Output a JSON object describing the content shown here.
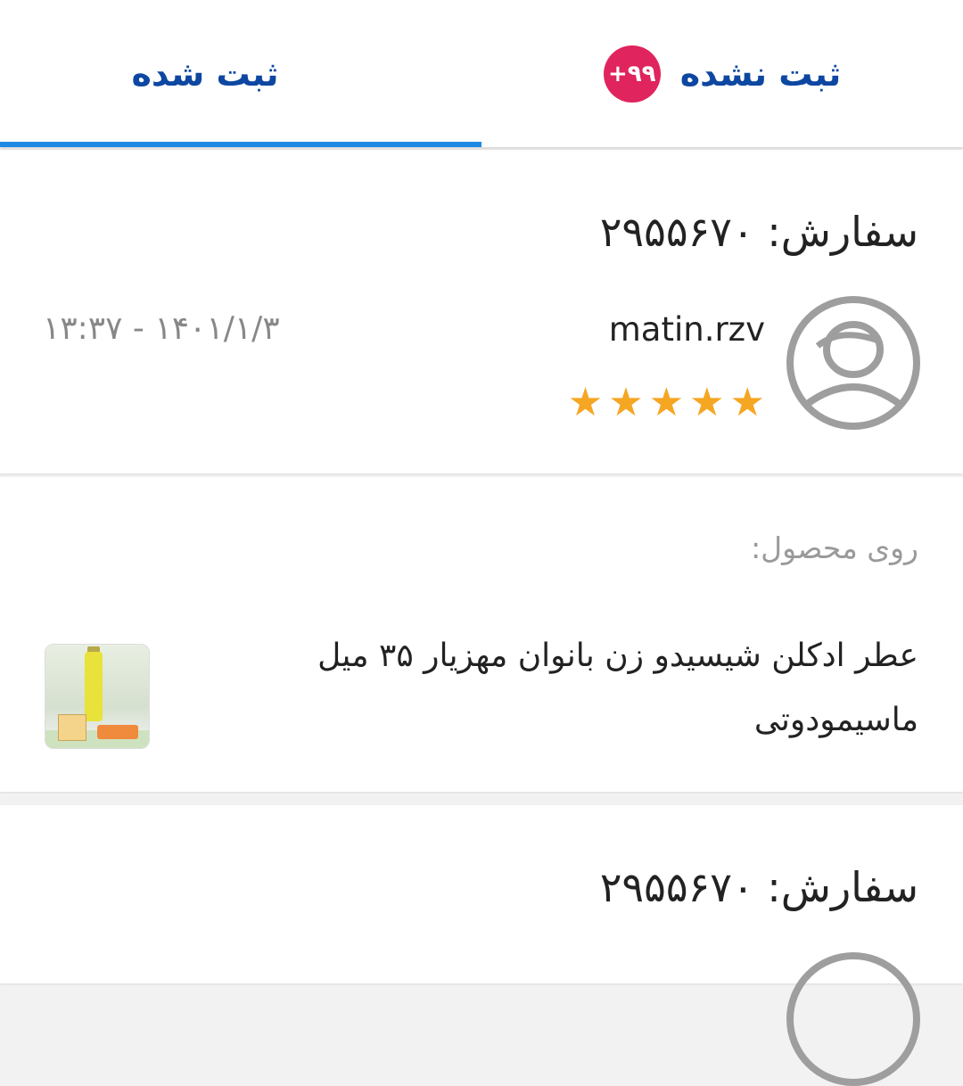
{
  "tabs": {
    "unregistered": {
      "label": "ثبت نشده",
      "badge": "+۹۹"
    },
    "registered": {
      "label": "ثبت شده"
    },
    "active": "registered"
  },
  "review": {
    "order_title": "سفارش: ۲۹۵۵۶۷۰",
    "username": "matin.rzv",
    "datetime": "۱۴۰۱/۱/۳ - ۱۳:۳۷",
    "rating": 5,
    "stars": [
      "★",
      "★",
      "★",
      "★",
      "★"
    ]
  },
  "product": {
    "caption": "روی محصول:",
    "name": "عطر ادکلن شیسیدو زن بانوان مهزیار ۳۵ میل ماسیمودوتی"
  },
  "next_review": {
    "order_title": "سفارش: ۲۹۵۵۶۷۰"
  },
  "colors": {
    "accent": "#1e88e5",
    "tab_text": "#0d47a1",
    "badge": "#e0245e",
    "star": "#f5a623"
  }
}
